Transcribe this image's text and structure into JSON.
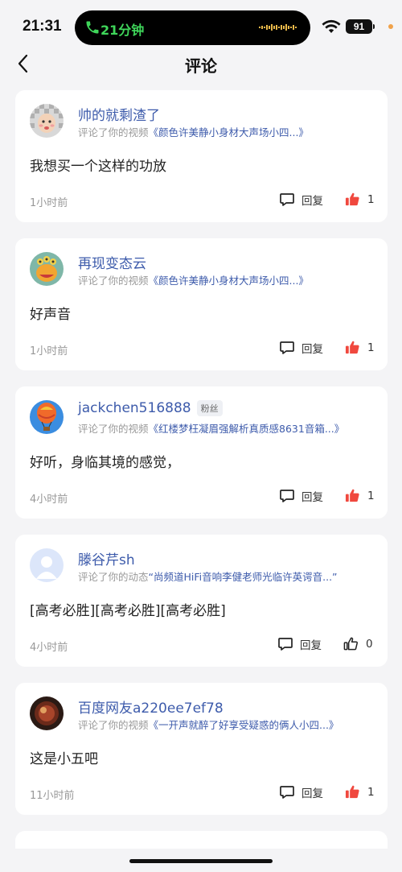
{
  "status_bar": {
    "time": "21:31",
    "call_duration": "21分钟",
    "battery": "91"
  },
  "header": {
    "title": "评论"
  },
  "comments": [
    {
      "name": "帅的就剩渣了",
      "badge": "",
      "action": "评论了你的视频",
      "target": "《颜色许美静小身材大声场小四...》",
      "text": "我想买一个这样的功放",
      "time": "1小时前",
      "reply_label": "回复",
      "likes": "1",
      "liked": true,
      "avatar": "baby-avatar"
    },
    {
      "name": "再现变态云",
      "badge": "",
      "action": "评论了你的视频",
      "target": "《颜色许美静小身材大声场小四...》",
      "text": "好声音",
      "time": "1小时前",
      "reply_label": "回复",
      "likes": "1",
      "liked": true,
      "avatar": "cartoon-avatar"
    },
    {
      "name": "jackchen516888",
      "badge": "粉丝",
      "action": "评论了你的视频",
      "target": "《红楼梦枉凝眉强解析真质感8631音箱...》",
      "text": "好听，身临其境的感觉，",
      "time": "4小时前",
      "reply_label": "回复",
      "likes": "1",
      "liked": true,
      "avatar": "balloon-avatar"
    },
    {
      "name": "滕谷芹sh",
      "badge": "",
      "action": "评论了你的动态",
      "target": "“尚频道HiFi音响李健老师光临许英谔音...”",
      "text": "[高考必胜][高考必胜][高考必胜]",
      "time": "4小时前",
      "reply_label": "回复",
      "likes": "0",
      "liked": false,
      "avatar": "default-avatar"
    },
    {
      "name": "百度网友a220ee7ef78",
      "badge": "",
      "action": "评论了你的视频",
      "target": "《一开声就醉了好享受疑惑的俩人小四...》",
      "text": "这是小五吧",
      "time": "11小时前",
      "reply_label": "回复",
      "likes": "1",
      "liked": true,
      "avatar": "dark-avatar"
    }
  ],
  "colors": {
    "name": "#3d5bab",
    "like_active": "#f0483e",
    "background": "#f4f4f6"
  }
}
